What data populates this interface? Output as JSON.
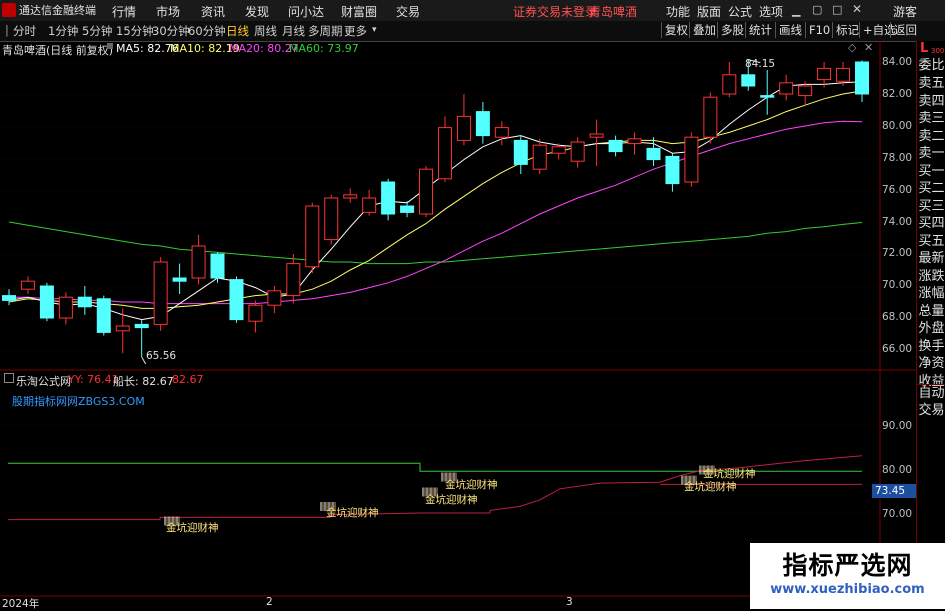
{
  "menubar": {
    "app_title": "通达信金融终端",
    "menus": [
      "行情",
      "市场",
      "资讯",
      "发现",
      "问小达",
      "财富圈",
      "交易"
    ],
    "status": "证券交易未登录",
    "stock_name": "青岛啤酒",
    "right_menus": [
      "功能",
      "版面",
      "公式",
      "选项"
    ],
    "user": "游客"
  },
  "toolbar": {
    "periods": [
      "分时",
      "1分钟",
      "5分钟",
      "15分钟",
      "30分钟",
      "60分钟",
      "日线",
      "周线",
      "月线",
      "多周期",
      "更多"
    ],
    "active_period": "日线",
    "buttons": [
      "复权",
      "叠加",
      "多股",
      "统计",
      "画线",
      "F10",
      "标记",
      "+自选",
      "返回"
    ]
  },
  "info": {
    "title": "青岛啤酒(日线 前复权)",
    "ma5_label": "MA5: 82.76",
    "ma10_label": "MA10: 82.19",
    "ma20_label": "MA20: 80.27",
    "ma60_label": "MA60: 73.97",
    "colors": {
      "ma5": "#ffffff",
      "ma10": "#ffff66",
      "ma20": "#ff44ff",
      "ma60": "#33cc33"
    }
  },
  "price_axis": {
    "ticks": [
      "84.00",
      "82.00",
      "80.00",
      "78.00",
      "76.00",
      "74.00",
      "72.00",
      "70.00",
      "68.00",
      "66.00"
    ],
    "high_label": "84.15",
    "low_label": "65.56"
  },
  "indicator": {
    "name": "乐淘公式网",
    "yy_label": "YY: 76.41",
    "chuanzhang_label": "船长: 82.67",
    "extra_value": "82.67",
    "website": "股期指标网网ZBGS3.COM",
    "ticks": [
      "90.00",
      "80.00",
      "70.00"
    ],
    "current_value": "73.45",
    "signal_text": "金坑迎财神"
  },
  "date_axis": {
    "labels": [
      "2024年",
      "2",
      "3"
    ]
  },
  "right_panel": {
    "top_label": "L",
    "top_sub": "300",
    "items": [
      "委比",
      "卖五",
      "卖四",
      "卖三",
      "卖二",
      "卖一",
      "买一",
      "买二",
      "买三",
      "买四",
      "买五",
      "最新",
      "涨跌",
      "涨幅",
      "总量",
      "外盘",
      "换手",
      "净资",
      "收益"
    ],
    "auto_trade_1": "自动",
    "auto_trade_2": "交易"
  },
  "watermark": {
    "title": "指标严选网",
    "url": "www.xuezhibiao.com"
  },
  "chart_data": {
    "type": "candlestick",
    "ylim": [
      65,
      85
    ],
    "candles": [
      {
        "o": 69.4,
        "c": 69.1,
        "h": 69.8,
        "l": 68.8
      },
      {
        "o": 69.8,
        "c": 70.3,
        "h": 70.6,
        "l": 69.5
      },
      {
        "o": 70.0,
        "c": 68.0,
        "h": 70.2,
        "l": 67.8
      },
      {
        "o": 68.0,
        "c": 69.3,
        "h": 69.6,
        "l": 67.6
      },
      {
        "o": 69.3,
        "c": 68.7,
        "h": 70.0,
        "l": 68.2
      },
      {
        "o": 69.2,
        "c": 67.1,
        "h": 69.4,
        "l": 66.9
      },
      {
        "o": 67.2,
        "c": 67.5,
        "h": 68.6,
        "l": 65.8
      },
      {
        "o": 67.6,
        "c": 67.4,
        "h": 67.9,
        "l": 65.56
      },
      {
        "o": 67.6,
        "c": 71.5,
        "h": 71.8,
        "l": 67.2
      },
      {
        "o": 70.5,
        "c": 70.3,
        "h": 71.4,
        "l": 69.5
      },
      {
        "o": 70.5,
        "c": 72.5,
        "h": 73.2,
        "l": 70.1
      },
      {
        "o": 72.0,
        "c": 70.5,
        "h": 72.1,
        "l": 70.2
      },
      {
        "o": 70.4,
        "c": 67.9,
        "h": 70.6,
        "l": 67.7
      },
      {
        "o": 67.8,
        "c": 68.8,
        "h": 69.1,
        "l": 67.1
      },
      {
        "o": 68.8,
        "c": 69.7,
        "h": 70.0,
        "l": 68.3
      },
      {
        "o": 69.4,
        "c": 71.4,
        "h": 72.0,
        "l": 68.9
      },
      {
        "o": 71.2,
        "c": 75.0,
        "h": 75.2,
        "l": 70.8
      },
      {
        "o": 72.9,
        "c": 75.5,
        "h": 75.7,
        "l": 72.6
      },
      {
        "o": 75.5,
        "c": 75.7,
        "h": 76.1,
        "l": 75.2
      },
      {
        "o": 74.6,
        "c": 75.5,
        "h": 76.0,
        "l": 74.4
      },
      {
        "o": 76.5,
        "c": 74.5,
        "h": 76.7,
        "l": 74.1
      },
      {
        "o": 75.0,
        "c": 74.6,
        "h": 75.3,
        "l": 74.3
      },
      {
        "o": 74.5,
        "c": 77.3,
        "h": 77.5,
        "l": 74.3
      },
      {
        "o": 76.7,
        "c": 79.9,
        "h": 80.6,
        "l": 76.5
      },
      {
        "o": 79.1,
        "c": 80.6,
        "h": 82.0,
        "l": 78.8
      },
      {
        "o": 80.9,
        "c": 79.4,
        "h": 81.5,
        "l": 78.9
      },
      {
        "o": 79.3,
        "c": 79.9,
        "h": 80.3,
        "l": 78.8
      },
      {
        "o": 79.1,
        "c": 77.6,
        "h": 79.4,
        "l": 77.0
      },
      {
        "o": 77.3,
        "c": 78.8,
        "h": 79.2,
        "l": 77.0
      },
      {
        "o": 78.3,
        "c": 78.7,
        "h": 78.9,
        "l": 77.9
      },
      {
        "o": 77.8,
        "c": 79.0,
        "h": 79.3,
        "l": 77.4
      },
      {
        "o": 79.3,
        "c": 79.5,
        "h": 80.4,
        "l": 77.5
      },
      {
        "o": 79.1,
        "c": 78.4,
        "h": 79.4,
        "l": 78.1
      },
      {
        "o": 78.9,
        "c": 79.2,
        "h": 79.6,
        "l": 78.2
      },
      {
        "o": 78.6,
        "c": 77.9,
        "h": 79.3,
        "l": 77.5
      },
      {
        "o": 78.1,
        "c": 76.4,
        "h": 78.3,
        "l": 75.9
      },
      {
        "o": 76.5,
        "c": 79.3,
        "h": 79.6,
        "l": 76.2
      },
      {
        "o": 79.3,
        "c": 81.8,
        "h": 82.1,
        "l": 78.9
      },
      {
        "o": 82.0,
        "c": 83.2,
        "h": 84.0,
        "l": 81.8
      },
      {
        "o": 83.2,
        "c": 82.5,
        "h": 84.15,
        "l": 82.2
      },
      {
        "o": 81.9,
        "c": 81.8,
        "h": 83.5,
        "l": 80.7
      },
      {
        "o": 82.0,
        "c": 82.7,
        "h": 83.2,
        "l": 81.6
      },
      {
        "o": 81.9,
        "c": 82.5,
        "h": 82.8,
        "l": 81.3
      },
      {
        "o": 82.9,
        "c": 83.6,
        "h": 84.0,
        "l": 82.4
      },
      {
        "o": 82.8,
        "c": 83.6,
        "h": 84.0,
        "l": 82.5
      },
      {
        "o": 84.0,
        "c": 82.0,
        "h": 84.1,
        "l": 81.5
      }
    ],
    "ma5": [
      69.1,
      69.3,
      69.0,
      68.8,
      68.9,
      68.6,
      68.2,
      67.9,
      68.1,
      68.9,
      69.7,
      70.5,
      70.3,
      69.9,
      69.3,
      69.5,
      71.0,
      72.3,
      73.7,
      75.0,
      75.3,
      75.2,
      76.1,
      77.0,
      77.9,
      78.7,
      79.2,
      79.4,
      79.0,
      78.8,
      78.7,
      78.9,
      78.9,
      79.0,
      78.9,
      78.3,
      78.4,
      79.1,
      80.1,
      81.0,
      81.8,
      82.5,
      82.6,
      82.6,
      82.7,
      82.76
    ],
    "ma10": [
      69.0,
      69.2,
      69.1,
      69.0,
      69.0,
      68.9,
      68.8,
      68.6,
      68.6,
      68.7,
      68.8,
      69.0,
      69.2,
      69.4,
      69.5,
      69.5,
      69.8,
      70.3,
      71.0,
      71.6,
      72.4,
      73.2,
      73.9,
      74.8,
      75.6,
      76.4,
      77.1,
      77.7,
      78.2,
      78.4,
      78.7,
      78.9,
      79.0,
      79.1,
      79.1,
      78.9,
      79.0,
      79.3,
      79.6,
      80.0,
      80.4,
      80.9,
      81.3,
      81.7,
      82.0,
      82.19
    ],
    "ma20": [
      69.3,
      69.3,
      69.2,
      69.2,
      69.1,
      69.1,
      69.0,
      69.0,
      68.9,
      68.9,
      68.9,
      68.9,
      68.9,
      68.9,
      69.0,
      69.1,
      69.2,
      69.4,
      69.6,
      69.9,
      70.2,
      70.6,
      71.1,
      71.6,
      72.2,
      72.8,
      73.3,
      73.9,
      74.5,
      75.0,
      75.5,
      75.9,
      76.3,
      76.8,
      77.3,
      77.7,
      78.1,
      78.5,
      78.9,
      79.2,
      79.5,
      79.8,
      80.0,
      80.2,
      80.3,
      80.27
    ],
    "ma60": [
      74.0,
      73.8,
      73.6,
      73.4,
      73.2,
      73.0,
      72.8,
      72.6,
      72.5,
      72.3,
      72.2,
      72.1,
      72.0,
      71.9,
      71.8,
      71.7,
      71.6,
      71.5,
      71.5,
      71.4,
      71.4,
      71.4,
      71.5,
      71.5,
      71.6,
      71.7,
      71.8,
      71.9,
      72.0,
      72.1,
      72.2,
      72.3,
      72.4,
      72.5,
      72.6,
      72.7,
      72.8,
      72.9,
      73.0,
      73.1,
      73.3,
      73.4,
      73.6,
      73.7,
      73.85,
      73.97
    ]
  }
}
